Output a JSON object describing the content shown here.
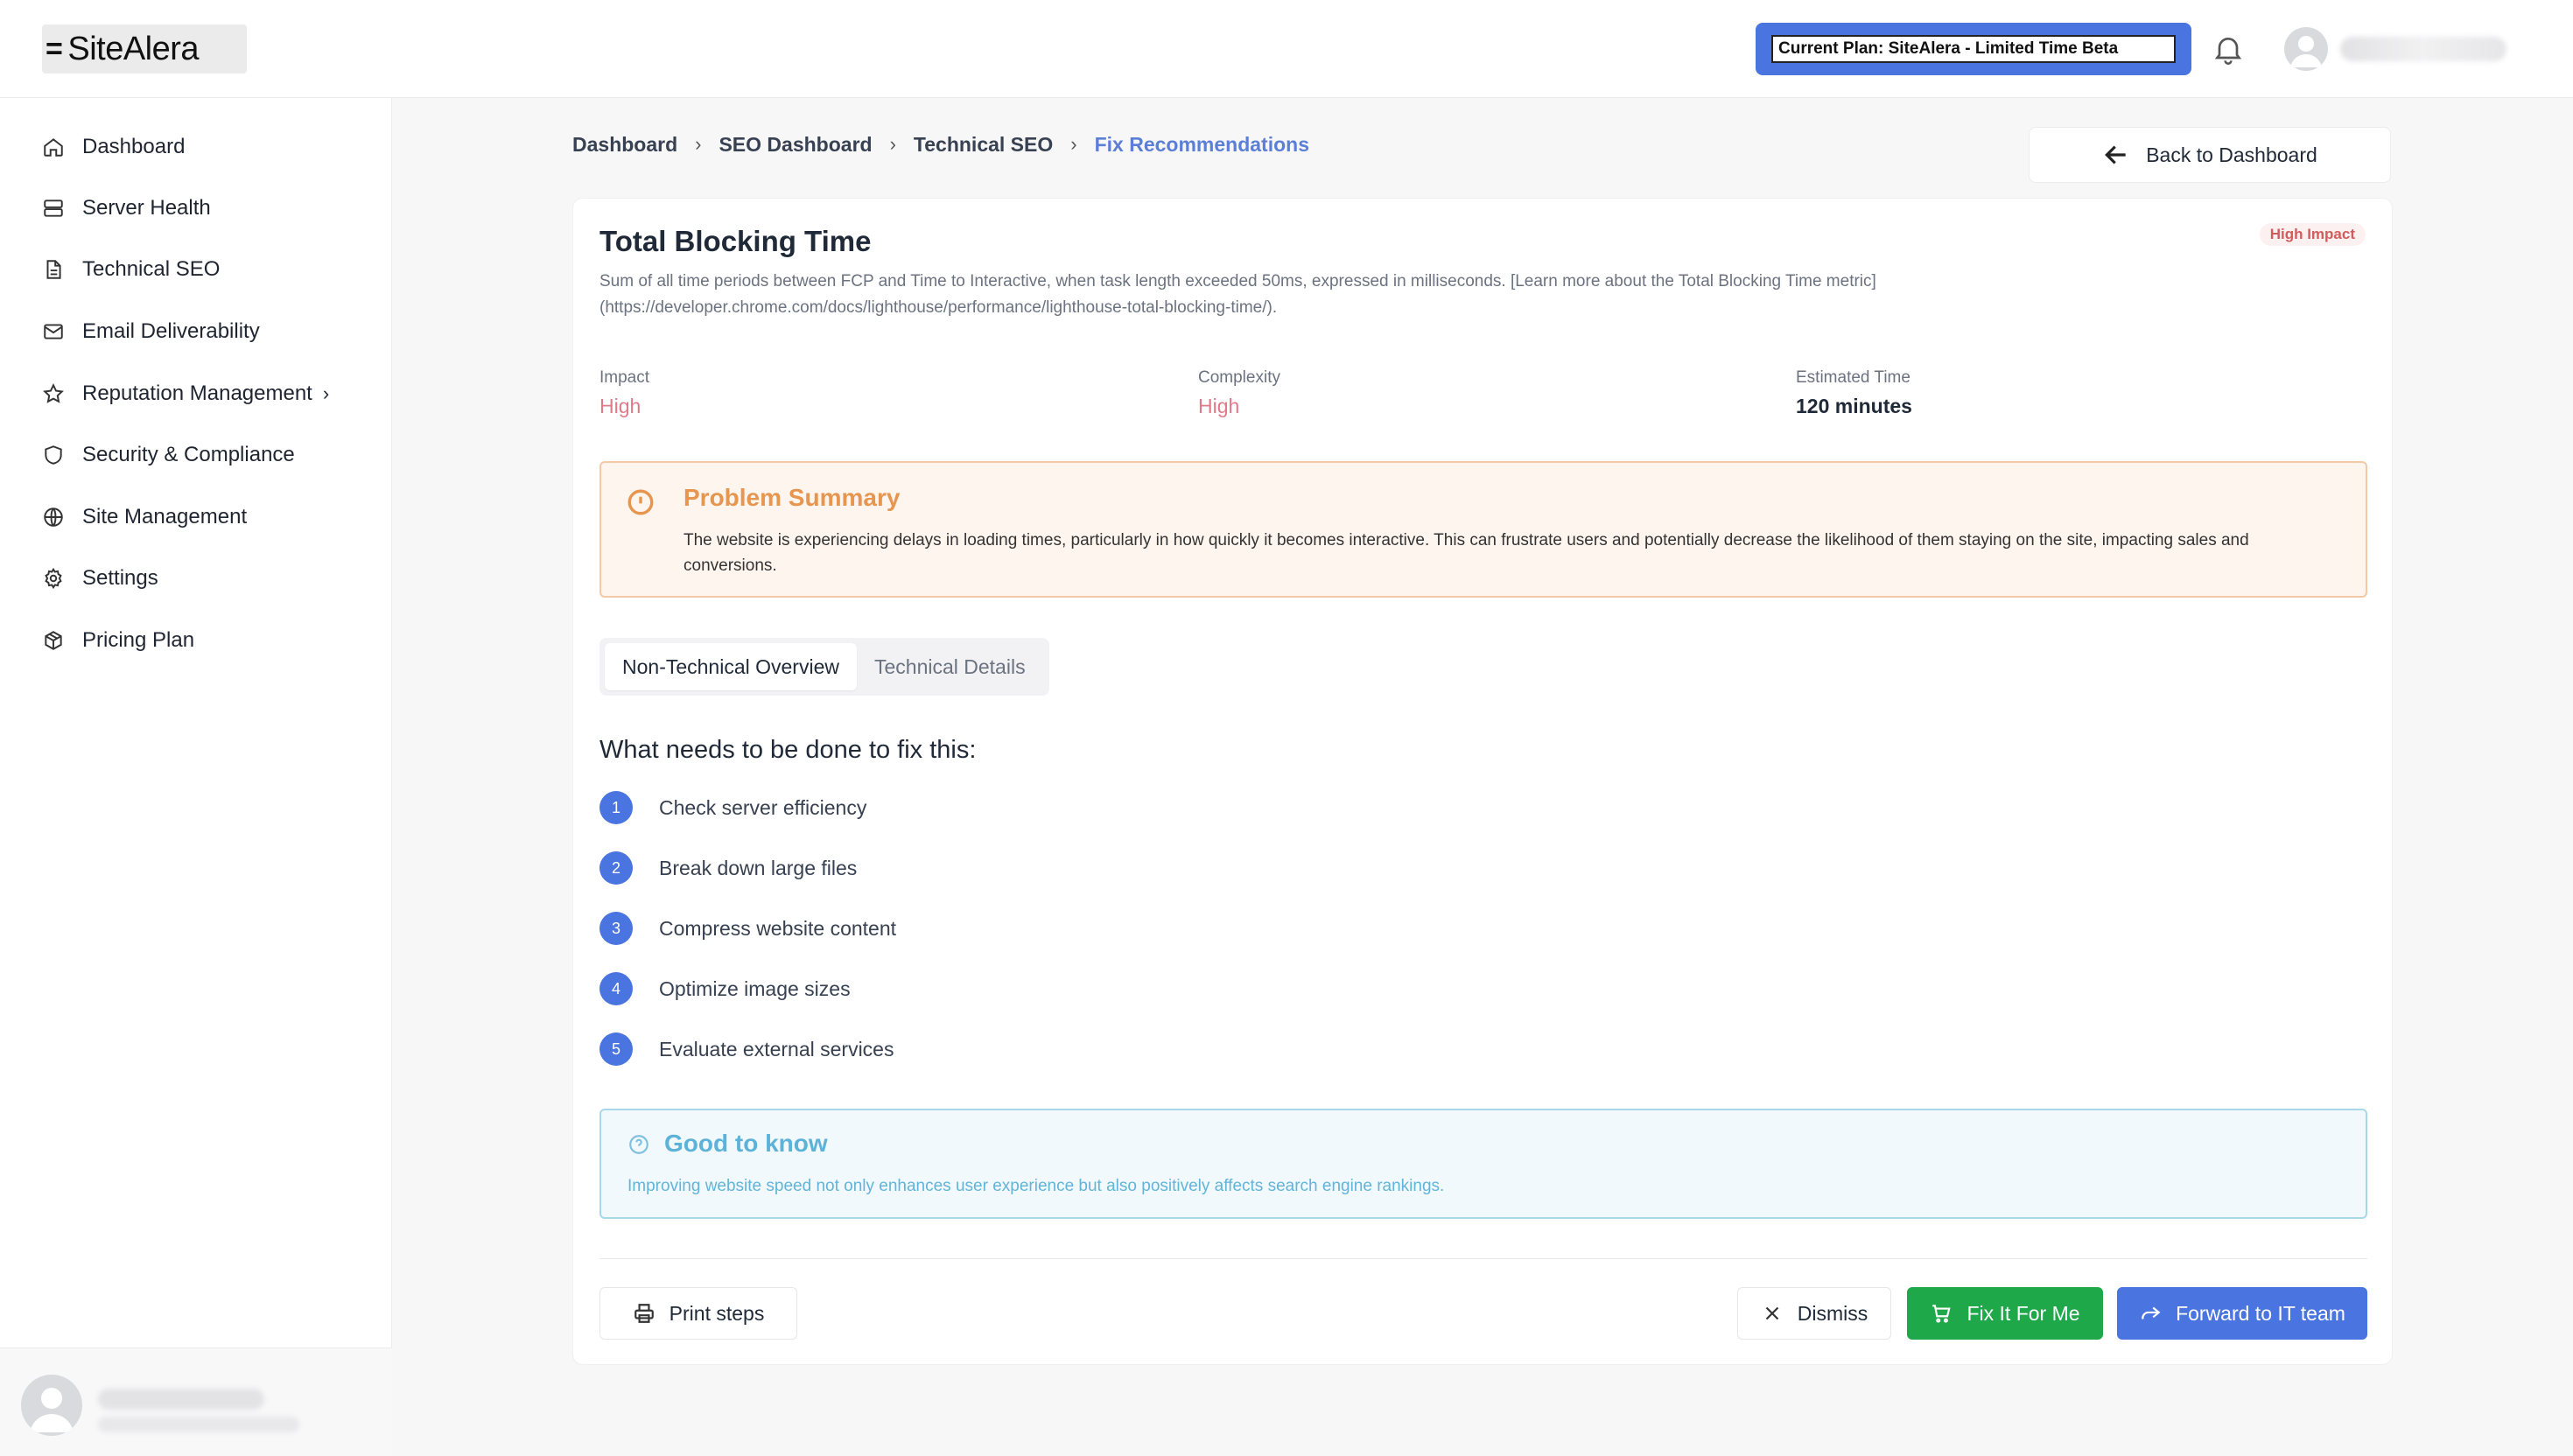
{
  "app": {
    "logo_text": "SiteAlera",
    "plan_label": "Current Plan: SiteAlera - Limited Time Beta"
  },
  "sidebar": {
    "items": [
      {
        "label": "Dashboard",
        "icon": "home-icon"
      },
      {
        "label": "Server Health",
        "icon": "server-icon"
      },
      {
        "label": "Technical SEO",
        "icon": "document-icon"
      },
      {
        "label": "Email Deliverability",
        "icon": "mail-icon"
      },
      {
        "label": "Reputation Management",
        "icon": "star-icon"
      },
      {
        "label": "Security & Compliance",
        "icon": "shield-icon"
      },
      {
        "label": "Site Management",
        "icon": "globe-icon"
      },
      {
        "label": "Settings",
        "icon": "gear-icon"
      },
      {
        "label": "Pricing Plan",
        "icon": "package-icon"
      }
    ]
  },
  "breadcrumb": [
    "Dashboard",
    "SEO Dashboard",
    "Technical SEO",
    "Fix Recommendations"
  ],
  "back_label": "Back to Dashboard",
  "issue": {
    "title": "Total Blocking Time",
    "badge": "High Impact",
    "description_line1": "Sum of all time periods between FCP and Time to Interactive, when task length exceeded 50ms, expressed in milliseconds. [Learn more about the Total Blocking Time metric]",
    "description_line2": "(https://developer.chrome.com/docs/lighthouse/performance/lighthouse-total-blocking-time/).",
    "impact_label": "Impact",
    "impact_value": "High",
    "complexity_label": "Complexity",
    "complexity_value": "High",
    "time_label": "Estimated Time",
    "time_value": "120 minutes"
  },
  "problem": {
    "title": "Problem Summary",
    "text": "The website is experiencing delays in loading times, particularly in how quickly it becomes interactive. This can frustrate users and potentially decrease the likelihood of them staying on the site, impacting sales and conversions."
  },
  "tabs": [
    "Non-Technical Overview",
    "Technical Details"
  ],
  "fix": {
    "title": "What needs to be done to fix this:",
    "steps": [
      {
        "num": "1",
        "text": "Check server efficiency"
      },
      {
        "num": "2",
        "text": "Break down large files"
      },
      {
        "num": "3",
        "text": "Compress website content"
      },
      {
        "num": "4",
        "text": "Optimize image sizes"
      },
      {
        "num": "5",
        "text": "Evaluate external services"
      }
    ]
  },
  "good_to_know": {
    "title": "Good to know",
    "text": "Improving website speed not only enhances user experience but also positively affects search engine rankings."
  },
  "actions": {
    "print": "Print steps",
    "dismiss": "Dismiss",
    "fix": "Fix It For Me",
    "forward": "Forward to IT team"
  },
  "colors": {
    "accent": "#4a74e0",
    "success": "#1fa84a",
    "warning": "#e6964f",
    "info": "#5db2d8",
    "danger": "#e07a8b"
  }
}
